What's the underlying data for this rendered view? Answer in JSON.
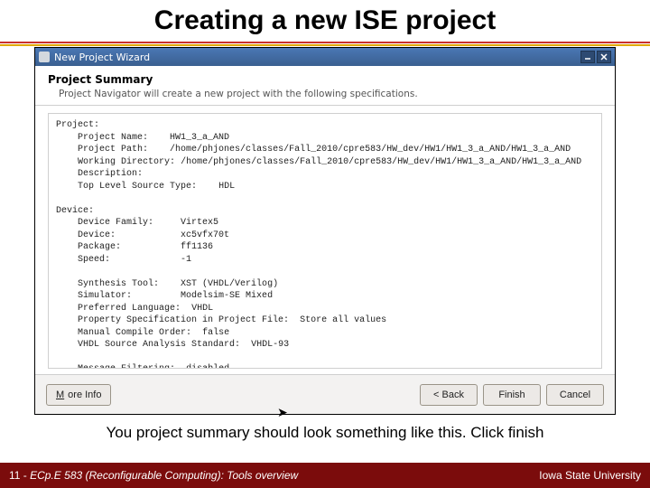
{
  "title": "Creating a new ISE project",
  "window": {
    "title": "New Project Wizard",
    "header": "Project Summary",
    "subheader": "Project Navigator will create a new project with the following specifications.",
    "buttons": {
      "more_info": "More Info",
      "back": "< Back",
      "finish": "Finish",
      "cancel": "Cancel"
    }
  },
  "summary": {
    "project_section": "Project:",
    "project_name_label": "Project Name:",
    "project_name": "HW1_3_a_AND",
    "project_path_label": "Project Path:",
    "project_path": "/home/phjones/classes/Fall_2010/cpre583/HW_dev/HW1/HW1_3_a_AND/HW1_3_a_AND",
    "working_dir_label": "Working Directory:",
    "working_dir": "/home/phjones/classes/Fall_2010/cpre583/HW_dev/HW1/HW1_3_a_AND/HW1_3_a_AND",
    "description_label": "Description:",
    "top_level_label": "Top Level Source Type:",
    "top_level": "HDL",
    "device_section": "Device:",
    "device_family_label": "Device Family:",
    "device_family": "Virtex5",
    "device_label": "Device:",
    "device": "xc5vfx70t",
    "package_label": "Package:",
    "package": "ff1136",
    "speed_label": "Speed:",
    "speed": "-1",
    "synth_label": "Synthesis Tool:",
    "synth": "XST (VHDL/Verilog)",
    "sim_label": "Simulator:",
    "sim": "Modelsim-SE Mixed",
    "lang_label": "Preferred Language:",
    "lang": "VHDL",
    "prop_label": "Property Specification in Project File:",
    "prop": "Store all values",
    "compile_label": "Manual Compile Order:",
    "compile": "false",
    "vhdl_std_label": "VHDL Source Analysis Standard:",
    "vhdl_std": "VHDL-93",
    "msg_label": "Message Filtering:",
    "msg": "disabled"
  },
  "caption": "You project summary should look something like this.  Click finish",
  "footer": {
    "page": "11 - ",
    "course": "ECp.E 583 (Reconfigurable Computing): Tools overview",
    "uni": "Iowa State University"
  }
}
